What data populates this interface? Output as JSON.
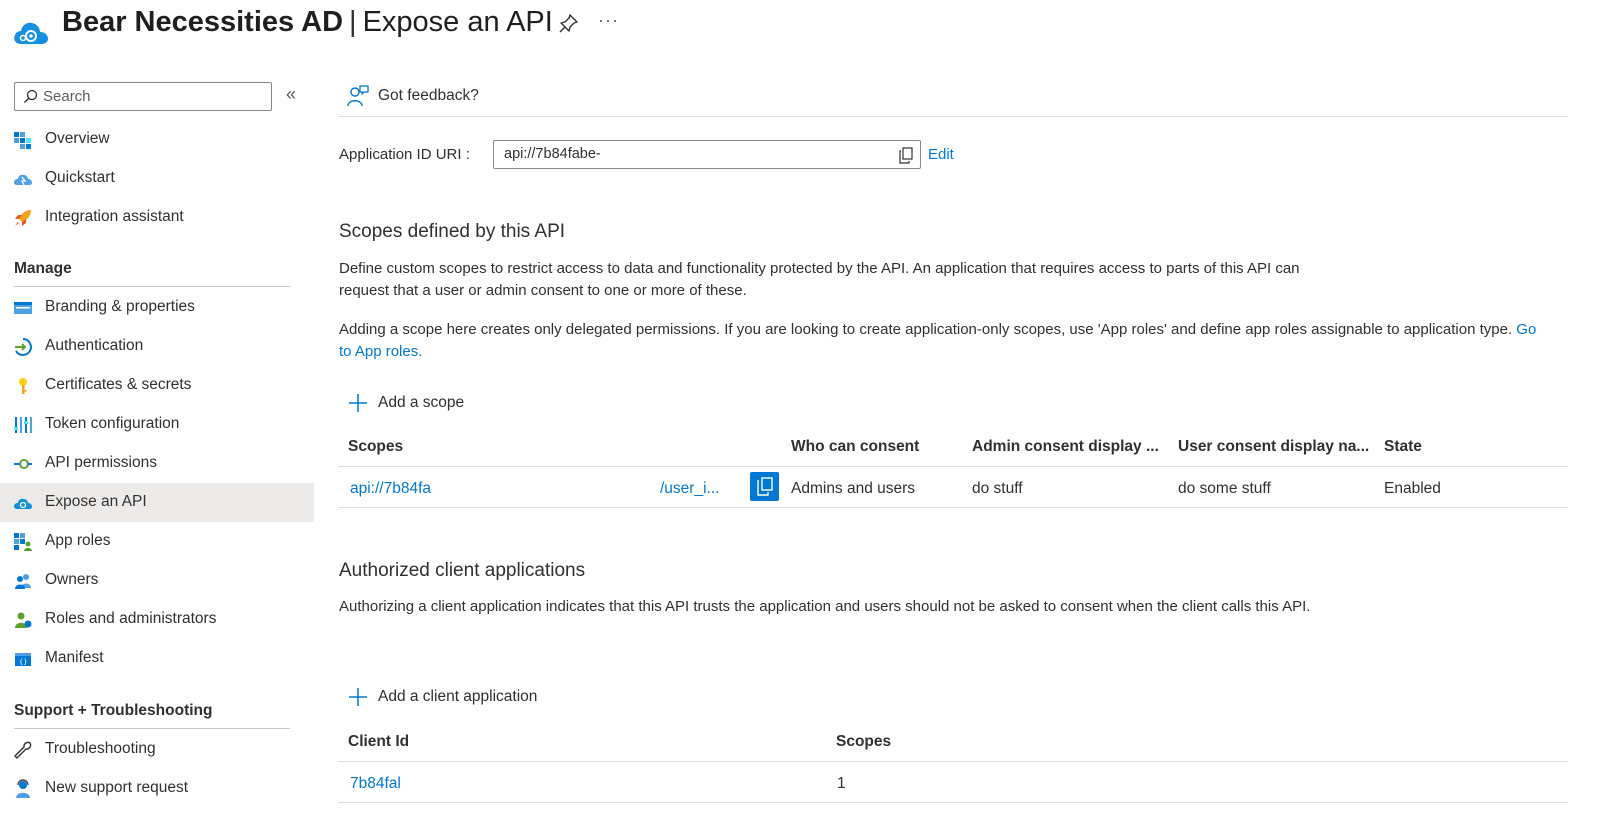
{
  "header": {
    "app_name": "Bear Necessities AD",
    "separator": "|",
    "page_name": "Expose an API",
    "app_icon": "cloud-gear-icon",
    "pin_icon": "pin-icon",
    "more_label": "···"
  },
  "sidebar": {
    "search_placeholder": "Search",
    "collapse_label": "«",
    "top_items": [
      {
        "label": "Overview",
        "icon": "overview-grid-icon"
      },
      {
        "label": "Quickstart",
        "icon": "quickstart-cloud-icon"
      },
      {
        "label": "Integration assistant",
        "icon": "rocket-icon"
      }
    ],
    "manage_heading": "Manage",
    "manage_items": [
      {
        "label": "Branding & properties",
        "icon": "branding-icon"
      },
      {
        "label": "Authentication",
        "icon": "authentication-icon"
      },
      {
        "label": "Certificates & secrets",
        "icon": "key-icon"
      },
      {
        "label": "Token configuration",
        "icon": "token-bars-icon"
      },
      {
        "label": "API permissions",
        "icon": "api-permissions-icon"
      },
      {
        "label": "Expose an API",
        "icon": "expose-api-cloud-icon",
        "selected": true
      },
      {
        "label": "App roles",
        "icon": "app-roles-icon"
      },
      {
        "label": "Owners",
        "icon": "owners-icon"
      },
      {
        "label": "Roles and administrators",
        "icon": "roles-admin-icon"
      },
      {
        "label": "Manifest",
        "icon": "manifest-icon"
      }
    ],
    "support_heading": "Support + Troubleshooting",
    "support_items": [
      {
        "label": "Troubleshooting",
        "icon": "wrench-icon"
      },
      {
        "label": "New support request",
        "icon": "support-person-icon"
      }
    ]
  },
  "toolbar": {
    "feedback_label": "Got feedback?",
    "feedback_icon": "feedback-person-icon"
  },
  "app_id_uri": {
    "label": "Application ID URI :",
    "value": "api://7b84fabe-",
    "copy_icon": "copy-icon",
    "edit_label": "Edit"
  },
  "scopes_section": {
    "title": "Scopes defined by this API",
    "description": "Define custom scopes to restrict access to data and functionality protected by the API. An application that requires access to parts of this API can request that a user or admin consent to one or more of these.",
    "note_text": "Adding a scope here creates only delegated permissions. If you are looking to create application-only scopes, use 'App roles' and define app roles assignable to application type.",
    "note_link": "Go to App roles.",
    "add_label": "Add a scope",
    "columns": [
      "Scopes",
      "Who can consent",
      "Admin consent display ...",
      "User consent display na...",
      "State"
    ],
    "rows": [
      {
        "scope_start": "api://7b84fa",
        "scope_end": "/user_i...",
        "who_can_consent": "Admins and users",
        "admin_consent_display": "do stuff",
        "user_consent_display": "do some stuff",
        "state": "Enabled"
      }
    ]
  },
  "clients_section": {
    "title": "Authorized client applications",
    "description": "Authorizing a client application indicates that this API trusts the application and users should not be asked to consent when the client calls this API.",
    "add_label": "Add a client application",
    "columns": [
      "Client Id",
      "Scopes"
    ],
    "rows": [
      {
        "client_id": "7b84fal",
        "scopes": "1"
      }
    ]
  },
  "colors": {
    "accent": "#0078d4",
    "selected_bg": "#edebe9",
    "text": "#323130"
  }
}
